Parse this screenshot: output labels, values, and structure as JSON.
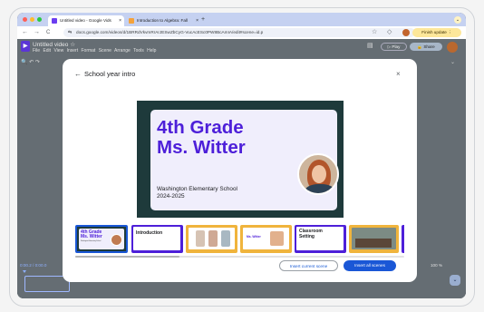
{
  "browser": {
    "tabs": [
      {
        "label": "Untitled video - Google Vids",
        "favicon_color": "#6b3df0",
        "close": "×"
      },
      {
        "label": "Introduction to Algebra: Fall",
        "favicon_color": "#f4a23b",
        "close": "×"
      }
    ],
    "new_tab": "+",
    "nav": {
      "back": "←",
      "forward": "→",
      "reload": "C"
    },
    "url": "docs.google.com/videos/d/1BRRdVkvmRrArJESwZbCyG-VucAcESc0PW8BcAmIA/edit#scene=id.p",
    "finish_update": "Finish update"
  },
  "app": {
    "logo_letter": "▶",
    "title": "Untitled video",
    "star": "☆",
    "menu": "File  Edit  View  Insert  Format  Scene  Arrange  Tools  Help",
    "play_label": "▷ Play",
    "share_label": "Share",
    "timeline": {
      "time": "0:00.2 / 0:00.0",
      "zoom": "100 %"
    }
  },
  "modal": {
    "title": "School year intro",
    "back": "←",
    "close": "×",
    "preview": {
      "title_line1": "4th Grade",
      "title_line2": "Ms. Witter",
      "school": "Washington Elementary School",
      "year": "2024-2025"
    },
    "thumbnails": [
      {
        "label": "4th Grade Ms. Witter",
        "sub": "Washington Elementary School",
        "selected": true
      },
      {
        "label": "Introduction",
        "selected": false
      },
      {
        "label": "",
        "selected": false
      },
      {
        "label": "Ms. Witter",
        "selected": false
      },
      {
        "label": "Classroom Setting",
        "selected": false
      },
      {
        "label": "",
        "selected": false
      }
    ],
    "insert_current": "Insert current scene",
    "insert_all": "Insert all scenes"
  },
  "colors": {
    "accent": "#1a57d6",
    "brand_purple": "#4d1fd9",
    "slide_bg": "#1e3a3b",
    "thumb_orange": "#f0b43c"
  }
}
